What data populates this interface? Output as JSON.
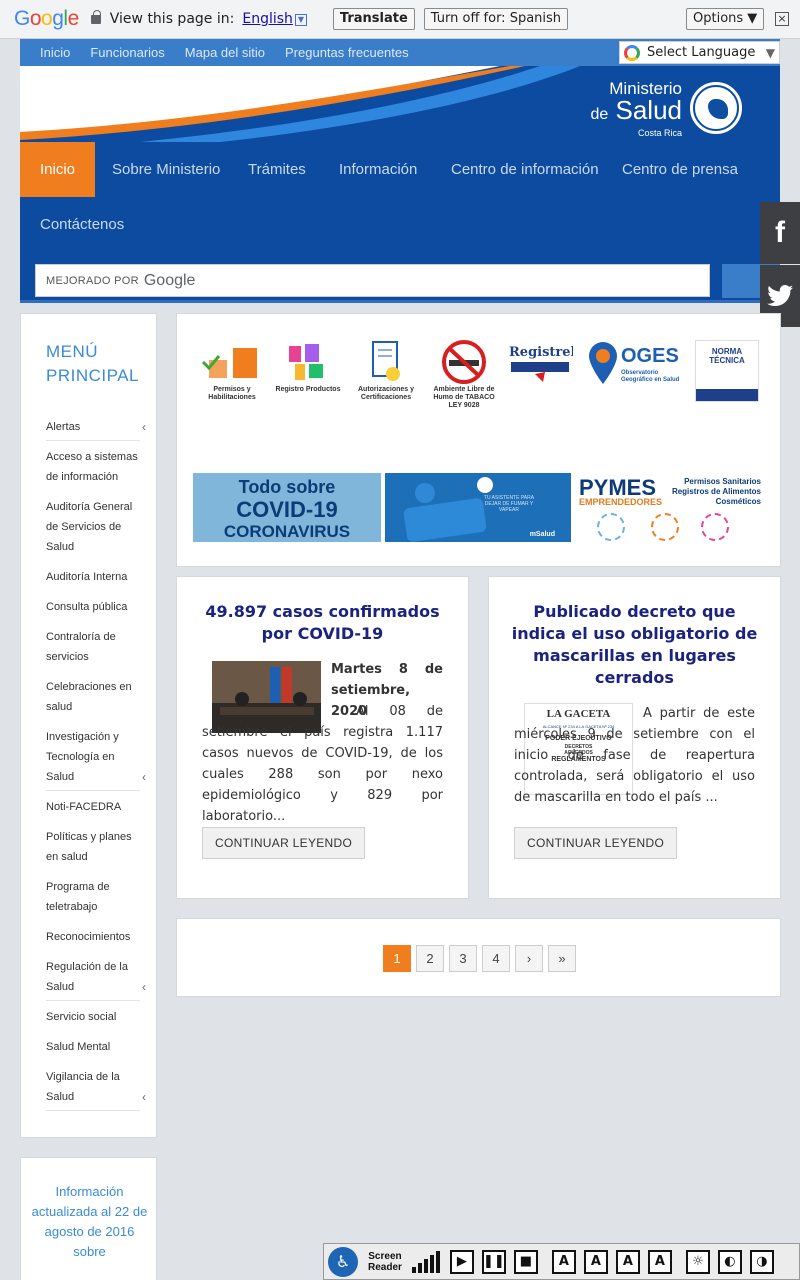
{
  "translate_bar": {
    "logo": "Google",
    "view_text": "View this page in:",
    "language": "English",
    "translate_button": "Translate",
    "turn_off_button": "Turn off for: Spanish",
    "options_button": "Options ▼",
    "close": "×"
  },
  "top_links": [
    "Inicio",
    "Funcionarios",
    "Mapa del sitio",
    "Preguntas frecuentes"
  ],
  "language_select": {
    "label": "Select Language",
    "arrow": "▼"
  },
  "brand": {
    "line1": "Ministerio",
    "line2_prefix": "de",
    "line2": "Salud",
    "line3": "Costa Rica"
  },
  "main_nav": [
    "Inicio",
    "Sobre Ministerio",
    "Trámites",
    "Información",
    "Centro de información",
    "Centro de prensa",
    "Contáctenos"
  ],
  "search": {
    "powered_by": "MEJORADO POR",
    "google": "Google"
  },
  "social": {
    "facebook": "f"
  },
  "sidebar": {
    "title": "MENÚ PRINCIPAL",
    "items": [
      {
        "label": "Alertas",
        "chevron": "‹"
      },
      {
        "label": "Acceso a sistemas de información",
        "chevron": ""
      },
      {
        "label": "Auditoría General de Servicios de Salud",
        "chevron": ""
      },
      {
        "label": "Auditoría Interna",
        "chevron": ""
      },
      {
        "label": "Consulta pública",
        "chevron": ""
      },
      {
        "label": "Contraloría de servicios",
        "chevron": ""
      },
      {
        "label": "Celebraciones en salud",
        "chevron": ""
      },
      {
        "label": "Investigación y Tecnología en Salud",
        "chevron": "‹"
      },
      {
        "label": "Noti-FACEDRA",
        "chevron": ""
      },
      {
        "label": "Políticas y planes en salud",
        "chevron": ""
      },
      {
        "label": "Programa de teletrabajo",
        "chevron": ""
      },
      {
        "label": "Reconocimientos",
        "chevron": ""
      },
      {
        "label": "Regulación de la Salud",
        "chevron": "‹"
      },
      {
        "label": "Servicio social",
        "chevron": ""
      },
      {
        "label": "Salud Mental",
        "chevron": ""
      },
      {
        "label": "Vigilancia de la Salud",
        "chevron": "‹"
      }
    ]
  },
  "sidebar2": {
    "text": "Información actualizada al 22 de agosto de 2016 sobre"
  },
  "logos": [
    {
      "name": "permisos-logo",
      "caption": "Permisos y Habilitaciones"
    },
    {
      "name": "registro-productos-logo",
      "caption": "Registro Productos"
    },
    {
      "name": "autorizaciones-logo",
      "caption": "Autorizaciones y Certificaciones"
    },
    {
      "name": "tabaco-logo",
      "caption": "Ambiente Libre de Humo de TABACO LEY 9028"
    },
    {
      "name": "registrelo-logo",
      "caption": "Registrelo"
    },
    {
      "name": "oges-logo",
      "caption": "OGES Observatorio Geográfico en Salud"
    },
    {
      "name": "norma-tecnica-logo",
      "caption": "NORMA TÉCNICA"
    }
  ],
  "banners": {
    "covid": {
      "line1": "Todo sobre",
      "line2": "COVID-19",
      "line3": "CORONAVIRUS"
    },
    "assistant": {
      "text": "TU ASISTENTE PARA DEJAR DE FUMAR Y VAPEAR",
      "brand": "mSalud"
    },
    "pymes": {
      "title": "PYMES",
      "subtitle": "EMPRENDEDORES",
      "right": "Permisos Sanitarios Registros de Alimentos Cosméticos"
    }
  },
  "news": [
    {
      "title": "49.897 casos confirmados por COVID-19",
      "date": "Martes 8 de setiembre, 2020",
      "body": ". Al 08 de setiembre el país registra 1.117 casos nuevos de COVID-19, de los cuales 288 son por nexo epidemiológico y 829 por laboratorio...",
      "button": "CONTINUAR LEYENDO"
    },
    {
      "title": "Publicado decreto que indica el uso obligatorio de mascarillas en lugares cerrados",
      "body": "A partir de este miércoles 9 de setiembre con el inicio de fase de reapertura controlada, será obligatorio el uso de mascarilla en todo el país ...",
      "button": "CONTINUAR LEYENDO",
      "thumb": {
        "masthead": "LA GACETA",
        "line": "ALCANCE Nº 234 A LA GACETA Nº 234",
        "section": "PODER EJECUTIVO",
        "sub1": "DECRETOS",
        "sub2": "ACUERDOS",
        "sub3": "REGLAMENTOS"
      }
    }
  ],
  "pagination": [
    "1",
    "2",
    "3",
    "4",
    "›",
    "»"
  ],
  "reader": {
    "title_line1": "Screen",
    "title_line2": "Reader"
  },
  "colors": {
    "nav_blue": "#0c4ba0",
    "accent_orange": "#f07d1e",
    "title_navy": "#1a237e",
    "link_blue": "#3a8bd6"
  }
}
